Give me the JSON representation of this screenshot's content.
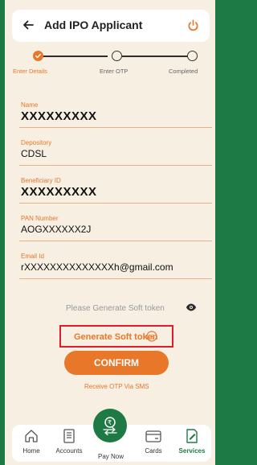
{
  "header": {
    "title": "Add IPO Applicant"
  },
  "stepper": {
    "steps": [
      {
        "label": "Enter Details",
        "state": "done"
      },
      {
        "label": "Enter OTP",
        "state": "pending"
      },
      {
        "label": "Completed",
        "state": "pending"
      }
    ]
  },
  "form": {
    "fields": [
      {
        "label": "Name",
        "value": "XXXXXXXXX"
      },
      {
        "label": "Depository",
        "value": "CDSL"
      },
      {
        "label": "Beneficiary ID",
        "value": "XXXXXXXXX"
      },
      {
        "label": "PAN Number",
        "value": "AOGXXXXXX2J"
      },
      {
        "label": "Email Id",
        "value": "rXXXXXXXXXXXXXXh@gmail.com"
      }
    ],
    "soft_token_placeholder": "Please Generate Soft token",
    "generate_soft_token_label": "Generate Soft token",
    "confirm_label": "CONFIRM",
    "receive_otp_label": "Receive OTP Via SMS"
  },
  "nav": {
    "items": [
      {
        "label": "Home",
        "icon": "home-icon"
      },
      {
        "label": "Accounts",
        "icon": "accounts-icon"
      },
      {
        "label": "Pay Now",
        "icon": "pay-now-icon"
      },
      {
        "label": "Cards",
        "icon": "card-icon"
      },
      {
        "label": "Services",
        "icon": "services-icon",
        "active": true
      }
    ]
  },
  "colors": {
    "accent": "#e9772a",
    "brand_green": "#1e7a45",
    "highlight_box": "#e21b2a",
    "background": "#f6efe2"
  }
}
